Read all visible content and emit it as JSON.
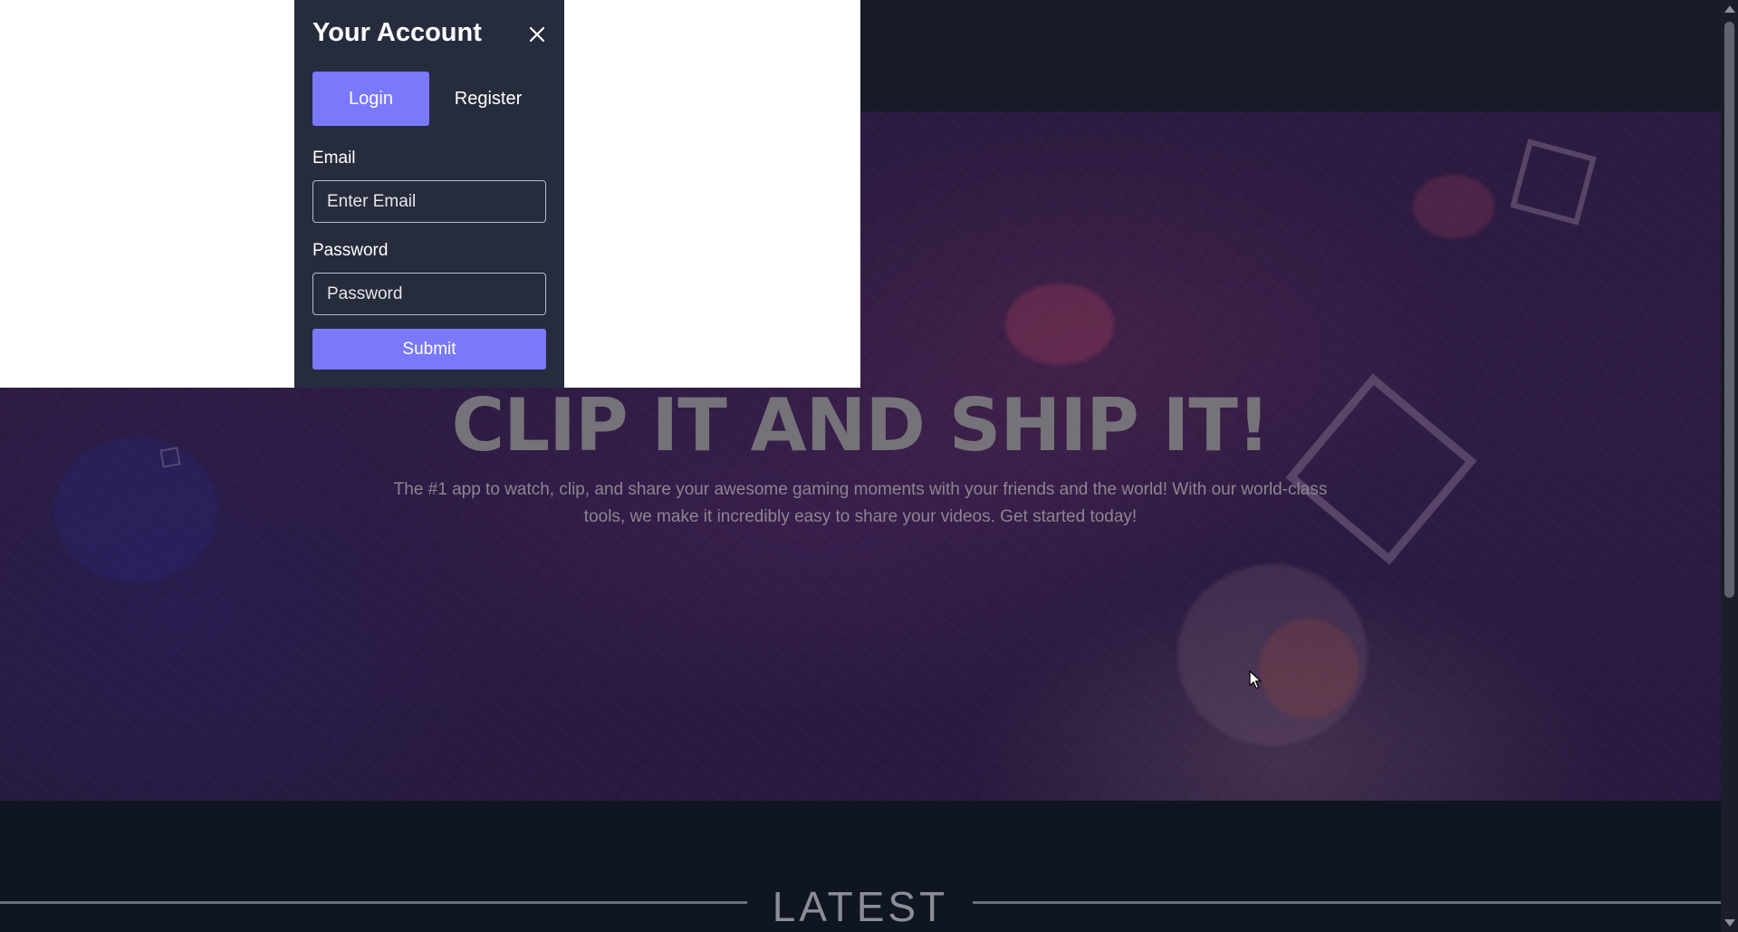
{
  "modal": {
    "title": "Your Account",
    "tabs": [
      "Login",
      "Register"
    ],
    "active_tab": "Login",
    "email_label": "Email",
    "email_placeholder": "Enter Email",
    "password_label": "Password",
    "password_placeholder": "Password",
    "submit_label": "Submit"
  },
  "hero": {
    "title": "CLIP IT AND SHIP IT!",
    "subtitle": "The #1 app to watch, clip, and share your awesome gaming moments with your friends and the world! With our world-class tools, we make it incredibly easy to share your videos. Get started today!"
  },
  "latest": {
    "title": "LATEST"
  },
  "colors": {
    "accent": "#7a78fb",
    "modal_bg": "#262c3c",
    "page_bg": "#111827"
  },
  "icons": {
    "close": "close-icon",
    "cursor": "mouse-cursor-icon"
  }
}
